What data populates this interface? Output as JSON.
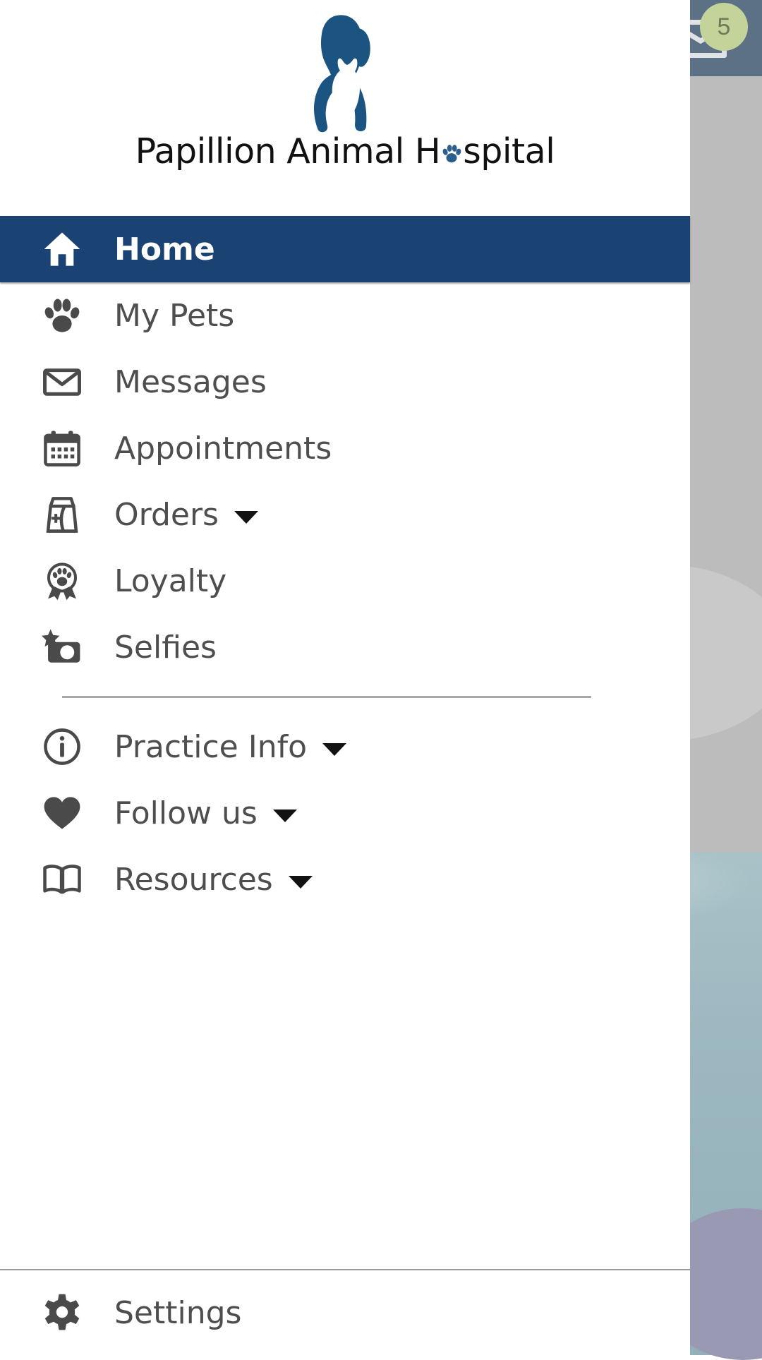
{
  "background": {
    "topbar": {
      "mail_icon": "mail-envelope-icon",
      "badge_count": "5",
      "badge_color": "#c3d39a",
      "bar_color": "#5d7186"
    },
    "panel_color": "#bcbcbc",
    "water_color": "#9db8c0",
    "accent_oval_color": "#9a99b4"
  },
  "drawer": {
    "close_label": "close-icon",
    "brand": {
      "name_part1": "Papillion Animal H",
      "name_part2": "spital",
      "full_name": "Papillion Animal Hospital",
      "logo_color": "#1b5480",
      "text_color": "#111111"
    },
    "accent_color": "#1a4272",
    "nav_primary": [
      {
        "id": "home",
        "label": "Home",
        "icon": "home-icon",
        "active": true,
        "has_caret": false
      },
      {
        "id": "my-pets",
        "label": "My Pets",
        "icon": "paw-icon",
        "active": false,
        "has_caret": false
      },
      {
        "id": "messages",
        "label": "Messages",
        "icon": "envelope-icon",
        "active": false,
        "has_caret": false
      },
      {
        "id": "appointments",
        "label": "Appointments",
        "icon": "calendar-icon",
        "active": false,
        "has_caret": false
      },
      {
        "id": "orders",
        "label": "Orders",
        "icon": "food-bag-icon",
        "active": false,
        "has_caret": true
      },
      {
        "id": "loyalty",
        "label": "Loyalty",
        "icon": "award-paw-icon",
        "active": false,
        "has_caret": false
      },
      {
        "id": "selfies",
        "label": "Selfies",
        "icon": "camera-star-icon",
        "active": false,
        "has_caret": false
      }
    ],
    "nav_secondary": [
      {
        "id": "practice-info",
        "label": "Practice Info",
        "icon": "info-circle-icon",
        "active": false,
        "has_caret": true
      },
      {
        "id": "follow-us",
        "label": "Follow us",
        "icon": "heart-icon",
        "active": false,
        "has_caret": true
      },
      {
        "id": "resources",
        "label": "Resources",
        "icon": "book-icon",
        "active": false,
        "has_caret": true
      }
    ],
    "nav_footer": [
      {
        "id": "settings",
        "label": "Settings",
        "icon": "gear-icon",
        "active": false,
        "has_caret": false
      }
    ]
  }
}
